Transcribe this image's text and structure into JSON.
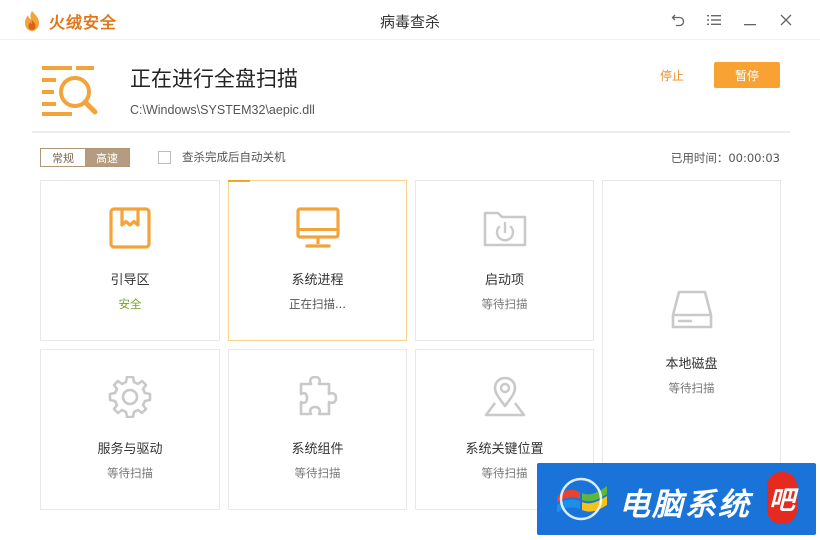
{
  "app": {
    "name": "火绒安全",
    "window_title": "病毒查杀",
    "brand_color": "#e0781a"
  },
  "header": {
    "title": "正在进行全盘扫描",
    "current_file": "C:\\Windows\\SYSTEM32\\aepic.dll",
    "stop_label": "停止",
    "pause_label": "暂停"
  },
  "options": {
    "mode_normal": "常规",
    "mode_fast": "高速",
    "selected_mode": "高速",
    "auto_shutdown_label": "查杀完成后自动关机",
    "auto_shutdown_checked": false,
    "elapsed_label": "已用时间：00:00:03"
  },
  "cards": [
    {
      "name": "引导区",
      "status": "安全",
      "icon": "boot-sector-icon",
      "state": "done"
    },
    {
      "name": "系统进程",
      "status": "正在扫描...",
      "icon": "monitor-icon",
      "state": "scanning"
    },
    {
      "name": "启动项",
      "status": "等待扫描",
      "icon": "startup-folder-icon",
      "state": "waiting"
    },
    {
      "name": "本地磁盘",
      "status": "等待扫描",
      "icon": "hard-disk-icon",
      "state": "waiting"
    },
    {
      "name": "服务与驱动",
      "status": "等待扫描",
      "icon": "gear-icon",
      "state": "waiting"
    },
    {
      "name": "系统组件",
      "status": "等待扫描",
      "icon": "puzzle-icon",
      "state": "waiting"
    },
    {
      "name": "系统关键位置",
      "status": "等待扫描",
      "icon": "location-pin-icon",
      "state": "waiting"
    }
  ],
  "watermark": {
    "text": "电脑系统",
    "badge": "吧"
  }
}
